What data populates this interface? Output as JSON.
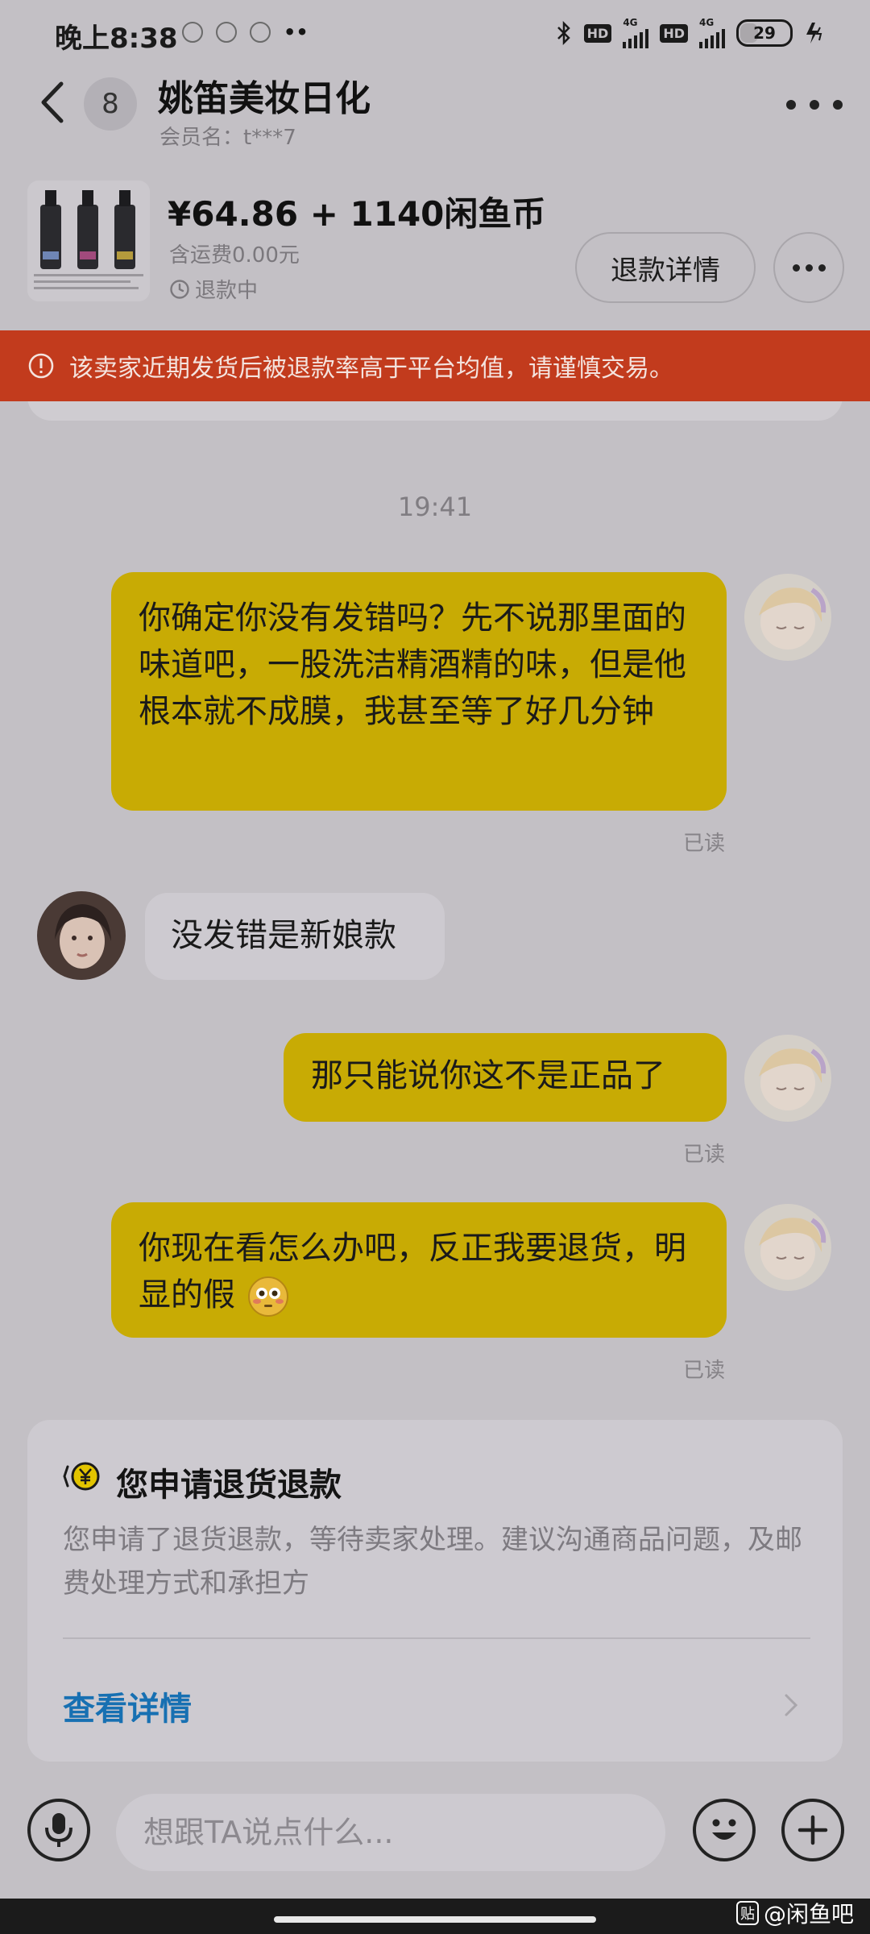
{
  "status_bar": {
    "time": "晚上8:38",
    "network_type": "4G",
    "hd_badge": "HD",
    "battery_level": "29",
    "dots": "••"
  },
  "header": {
    "unread_count": "8",
    "shop_name": "姚笛美妆日化",
    "member_label": "会员名：t***7"
  },
  "product": {
    "price": "¥64.86 + 1140闲鱼币",
    "shipping": "含运费0.00元",
    "status": "退款中",
    "refund_detail_button": "退款详情"
  },
  "warning": {
    "text": "该卖家近期发货后被退款率高于平台均值，请谨慎交易。"
  },
  "chat": {
    "timestamp": "19:41",
    "messages": [
      {
        "text": "你确定你没有发错吗？先不说那里面的味道吧，一股洗洁精酒精的味，但是他根本就不成膜，我甚至等了好几分钟",
        "read": "已读"
      },
      {
        "text": "没发错是新娘款"
      },
      {
        "text": "那只能说你这不是正品了",
        "read": "已读"
      },
      {
        "text": "你现在看怎么办吧，反正我要退货，明显的假",
        "read": "已读"
      }
    ]
  },
  "refund_card": {
    "title": "您申请退货退款",
    "body": "您申请了退货退款，等待卖家处理。建议沟通商品问题，及邮费处理方式和承担方",
    "link": "查看详情"
  },
  "input": {
    "placeholder": "想跟TA说点什么..."
  },
  "watermark": {
    "logo": "贴",
    "text": "@闲鱼吧"
  },
  "colors": {
    "background": "#c3c0c5",
    "outgoing_bubble": "#c8ab04",
    "incoming_bubble": "#cdcad0",
    "warning_banner": "#c23b1d",
    "link": "#1770b2"
  }
}
